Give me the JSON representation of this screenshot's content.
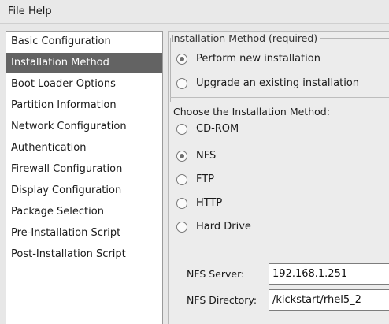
{
  "menu": {
    "file": "File",
    "help": "Help"
  },
  "sidebar": {
    "items": [
      {
        "label": "Basic Configuration"
      },
      {
        "label": "Installation Method"
      },
      {
        "label": "Boot Loader Options"
      },
      {
        "label": "Partition Information"
      },
      {
        "label": "Network Configuration"
      },
      {
        "label": "Authentication"
      },
      {
        "label": "Firewall Configuration"
      },
      {
        "label": "Display Configuration"
      },
      {
        "label": "Package Selection"
      },
      {
        "label": "Pre-Installation Script"
      },
      {
        "label": "Post-Installation Script"
      }
    ],
    "selected": "Installation Method"
  },
  "method": {
    "legend": "Installation Method (required)",
    "options": [
      {
        "label": "Perform new installation",
        "checked": true
      },
      {
        "label": "Upgrade an existing installation",
        "checked": false
      }
    ]
  },
  "source": {
    "heading": "Choose the Installation Method:",
    "options": [
      {
        "label": "CD-ROM",
        "checked": false
      },
      {
        "label": "NFS",
        "checked": true
      },
      {
        "label": "FTP",
        "checked": false
      },
      {
        "label": "HTTP",
        "checked": false
      },
      {
        "label": "Hard Drive",
        "checked": false
      }
    ]
  },
  "nfs": {
    "server_label": "NFS Server:",
    "server_value": "192.168.1.251",
    "directory_label": "NFS Directory:",
    "directory_value": "/kickstart/rhel5_2"
  }
}
